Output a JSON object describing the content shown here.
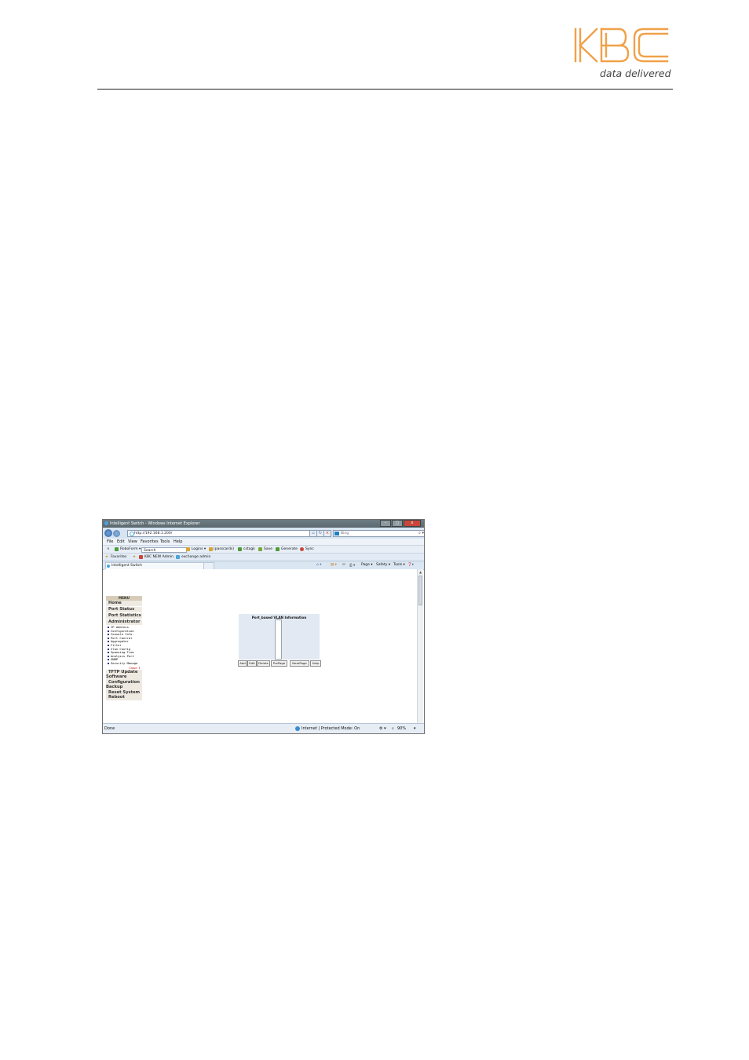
{
  "header": {
    "logo_text": "KBC",
    "tagline": "data delivered",
    "brand_color": "#f0a149"
  },
  "browser": {
    "window_title": "Intelligent Switch - Windows Internet Explorer",
    "address": "http://192.168.1.200/",
    "search_engine": "Bing",
    "menu": [
      "File",
      "Edit",
      "View",
      "Favorites",
      "Tools",
      "Help"
    ],
    "toolbar": {
      "close_x": "×",
      "roboform": "RoboForm ▾",
      "search_value": "Search",
      "logins": "Logins ▾",
      "passcards": "(passcards)",
      "items": [
        "cstagk",
        "Save",
        "Generate",
        "Sync"
      ]
    },
    "favorites": {
      "label": "Favorites",
      "items": [
        "KBC NEW Admin",
        "exchange admin"
      ]
    },
    "tab_label": "Intelligent Switch",
    "command_bar": [
      "Page ▾",
      "Safety ▾",
      "Tools ▾"
    ],
    "status": {
      "left": "Done",
      "zone": "Internet | Protected Mode: On",
      "zoom": "90%"
    }
  },
  "switch_page": {
    "menu_header": "MENU",
    "main_items": [
      "Home",
      "Port Status",
      "Port Statistics",
      "Administrator"
    ],
    "admin_subitems": [
      "IP Address",
      "Configuration",
      "Console Info.",
      "Port Control",
      "Aggregator",
      "Filter",
      "Vlan Config",
      "Spanning Tree",
      "Analysis Port",
      "SNMP",
      "Security Manage"
    ],
    "close_label": "Close",
    "after_items": [
      "TFTP Update",
      "Software",
      "Configuration",
      "Backup",
      "Reset System",
      "Reboot"
    ],
    "vlan_panel": {
      "title": "Port_based VLAN Information",
      "buttons": [
        "Add",
        "Edit",
        "Delete",
        "PrePage",
        "NextPage",
        "Help"
      ]
    }
  }
}
